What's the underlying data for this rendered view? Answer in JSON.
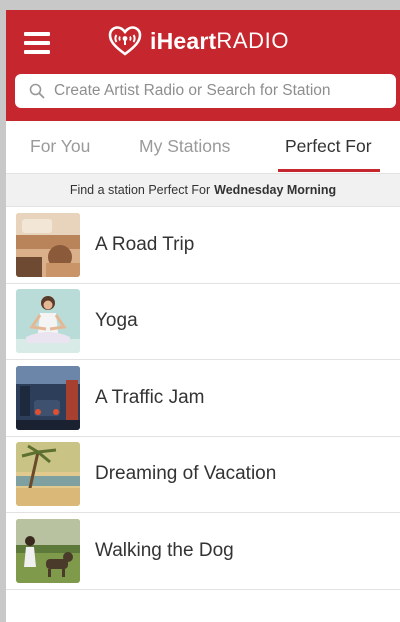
{
  "header": {
    "logo_brand": "iHeart",
    "logo_brand2": "RADIO",
    "menu_icon": "hamburger-menu-icon",
    "logo_icon": "iheart-logo-icon"
  },
  "search": {
    "placeholder": "Create Artist Radio or Search for Station",
    "icon": "search-icon"
  },
  "tabs": [
    {
      "label": "For You",
      "active": false
    },
    {
      "label": "My Stations",
      "active": false
    },
    {
      "label": "Perfect For",
      "active": true
    }
  ],
  "banner": {
    "prefix": "Find a station Perfect For",
    "when": "Wednesday Morning"
  },
  "stations": [
    {
      "label": "A Road Trip",
      "thumbnail": "road-trip-photo"
    },
    {
      "label": "Yoga",
      "thumbnail": "yoga-photo"
    },
    {
      "label": "A Traffic Jam",
      "thumbnail": "traffic-jam-photo"
    },
    {
      "label": "Dreaming of Vacation",
      "thumbnail": "vacation-photo"
    },
    {
      "label": "Walking the Dog",
      "thumbnail": "walking-dog-photo"
    }
  ],
  "colors": {
    "brand_red": "#c6262e",
    "background_gray": "#c8c8c8"
  }
}
